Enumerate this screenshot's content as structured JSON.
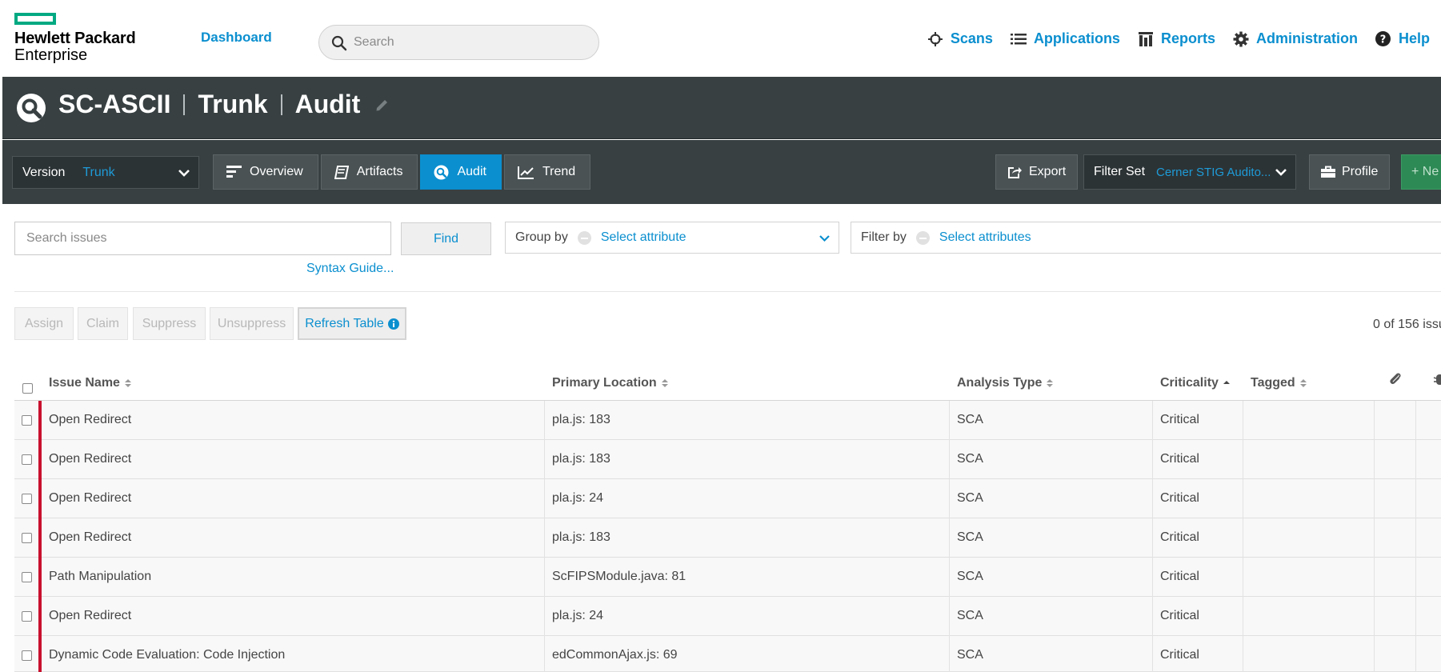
{
  "brand": {
    "line1": "Hewlett Packard",
    "line2": "Enterprise",
    "accent": "#01a982"
  },
  "nav": {
    "dashboard": "Dashboard",
    "search_placeholder": "Search",
    "links": [
      {
        "label": "Scans",
        "icon": "crosshair-icon"
      },
      {
        "label": "Applications",
        "icon": "list-icon"
      },
      {
        "label": "Reports",
        "icon": "reports-icon"
      },
      {
        "label": "Administration",
        "icon": "gear-icon"
      },
      {
        "label": "Help",
        "icon": "question-icon"
      }
    ]
  },
  "title": {
    "app": "SC-ASCII",
    "version": "Trunk",
    "page": "Audit"
  },
  "toolbar": {
    "version_label": "Version",
    "version_value": "Trunk",
    "tabs": [
      "Overview",
      "Artifacts",
      "Audit",
      "Trend"
    ],
    "active_tab": "Audit",
    "export": "Export",
    "filterset_label": "Filter Set",
    "filterset_value": "Cerner STIG Audito...",
    "profile": "Profile",
    "new_label": "+ Ne"
  },
  "search": {
    "placeholder": "Search issues",
    "find": "Find",
    "syntax": "Syntax Guide...",
    "groupby_label": "Group by",
    "groupby_value": "Select attribute",
    "filterby_label": "Filter by",
    "filterby_value": "Select attributes"
  },
  "actions": {
    "assign": "Assign",
    "claim": "Claim",
    "suppress": "Suppress",
    "unsuppress": "Unsuppress",
    "refresh": "Refresh Table",
    "count": "0 of 156 issu"
  },
  "table": {
    "columns": [
      "Issue Name",
      "Primary Location",
      "Analysis Type",
      "Criticality",
      "Tagged"
    ],
    "rows": [
      {
        "name": "Open Redirect",
        "location": "pla.js: 183",
        "type": "SCA",
        "criticality": "Critical"
      },
      {
        "name": "Open Redirect",
        "location": "pla.js: 183",
        "type": "SCA",
        "criticality": "Critical"
      },
      {
        "name": "Open Redirect",
        "location": "pla.js: 24",
        "type": "SCA",
        "criticality": "Critical"
      },
      {
        "name": "Open Redirect",
        "location": "pla.js: 183",
        "type": "SCA",
        "criticality": "Critical"
      },
      {
        "name": "Path Manipulation",
        "location": "ScFIPSModule.java: 81",
        "type": "SCA",
        "criticality": "Critical"
      },
      {
        "name": "Open Redirect",
        "location": "pla.js: 24",
        "type": "SCA",
        "criticality": "Critical"
      },
      {
        "name": "Dynamic Code Evaluation: Code Injection",
        "location": "edCommonAjax.js: 69",
        "type": "SCA",
        "criticality": "Critical"
      }
    ]
  },
  "colors": {
    "link": "#0b8fcf",
    "header_bg": "#384042",
    "active_tab": "#0b8fcf",
    "critical": "#c8102e",
    "new_button": "#2e8a55"
  }
}
